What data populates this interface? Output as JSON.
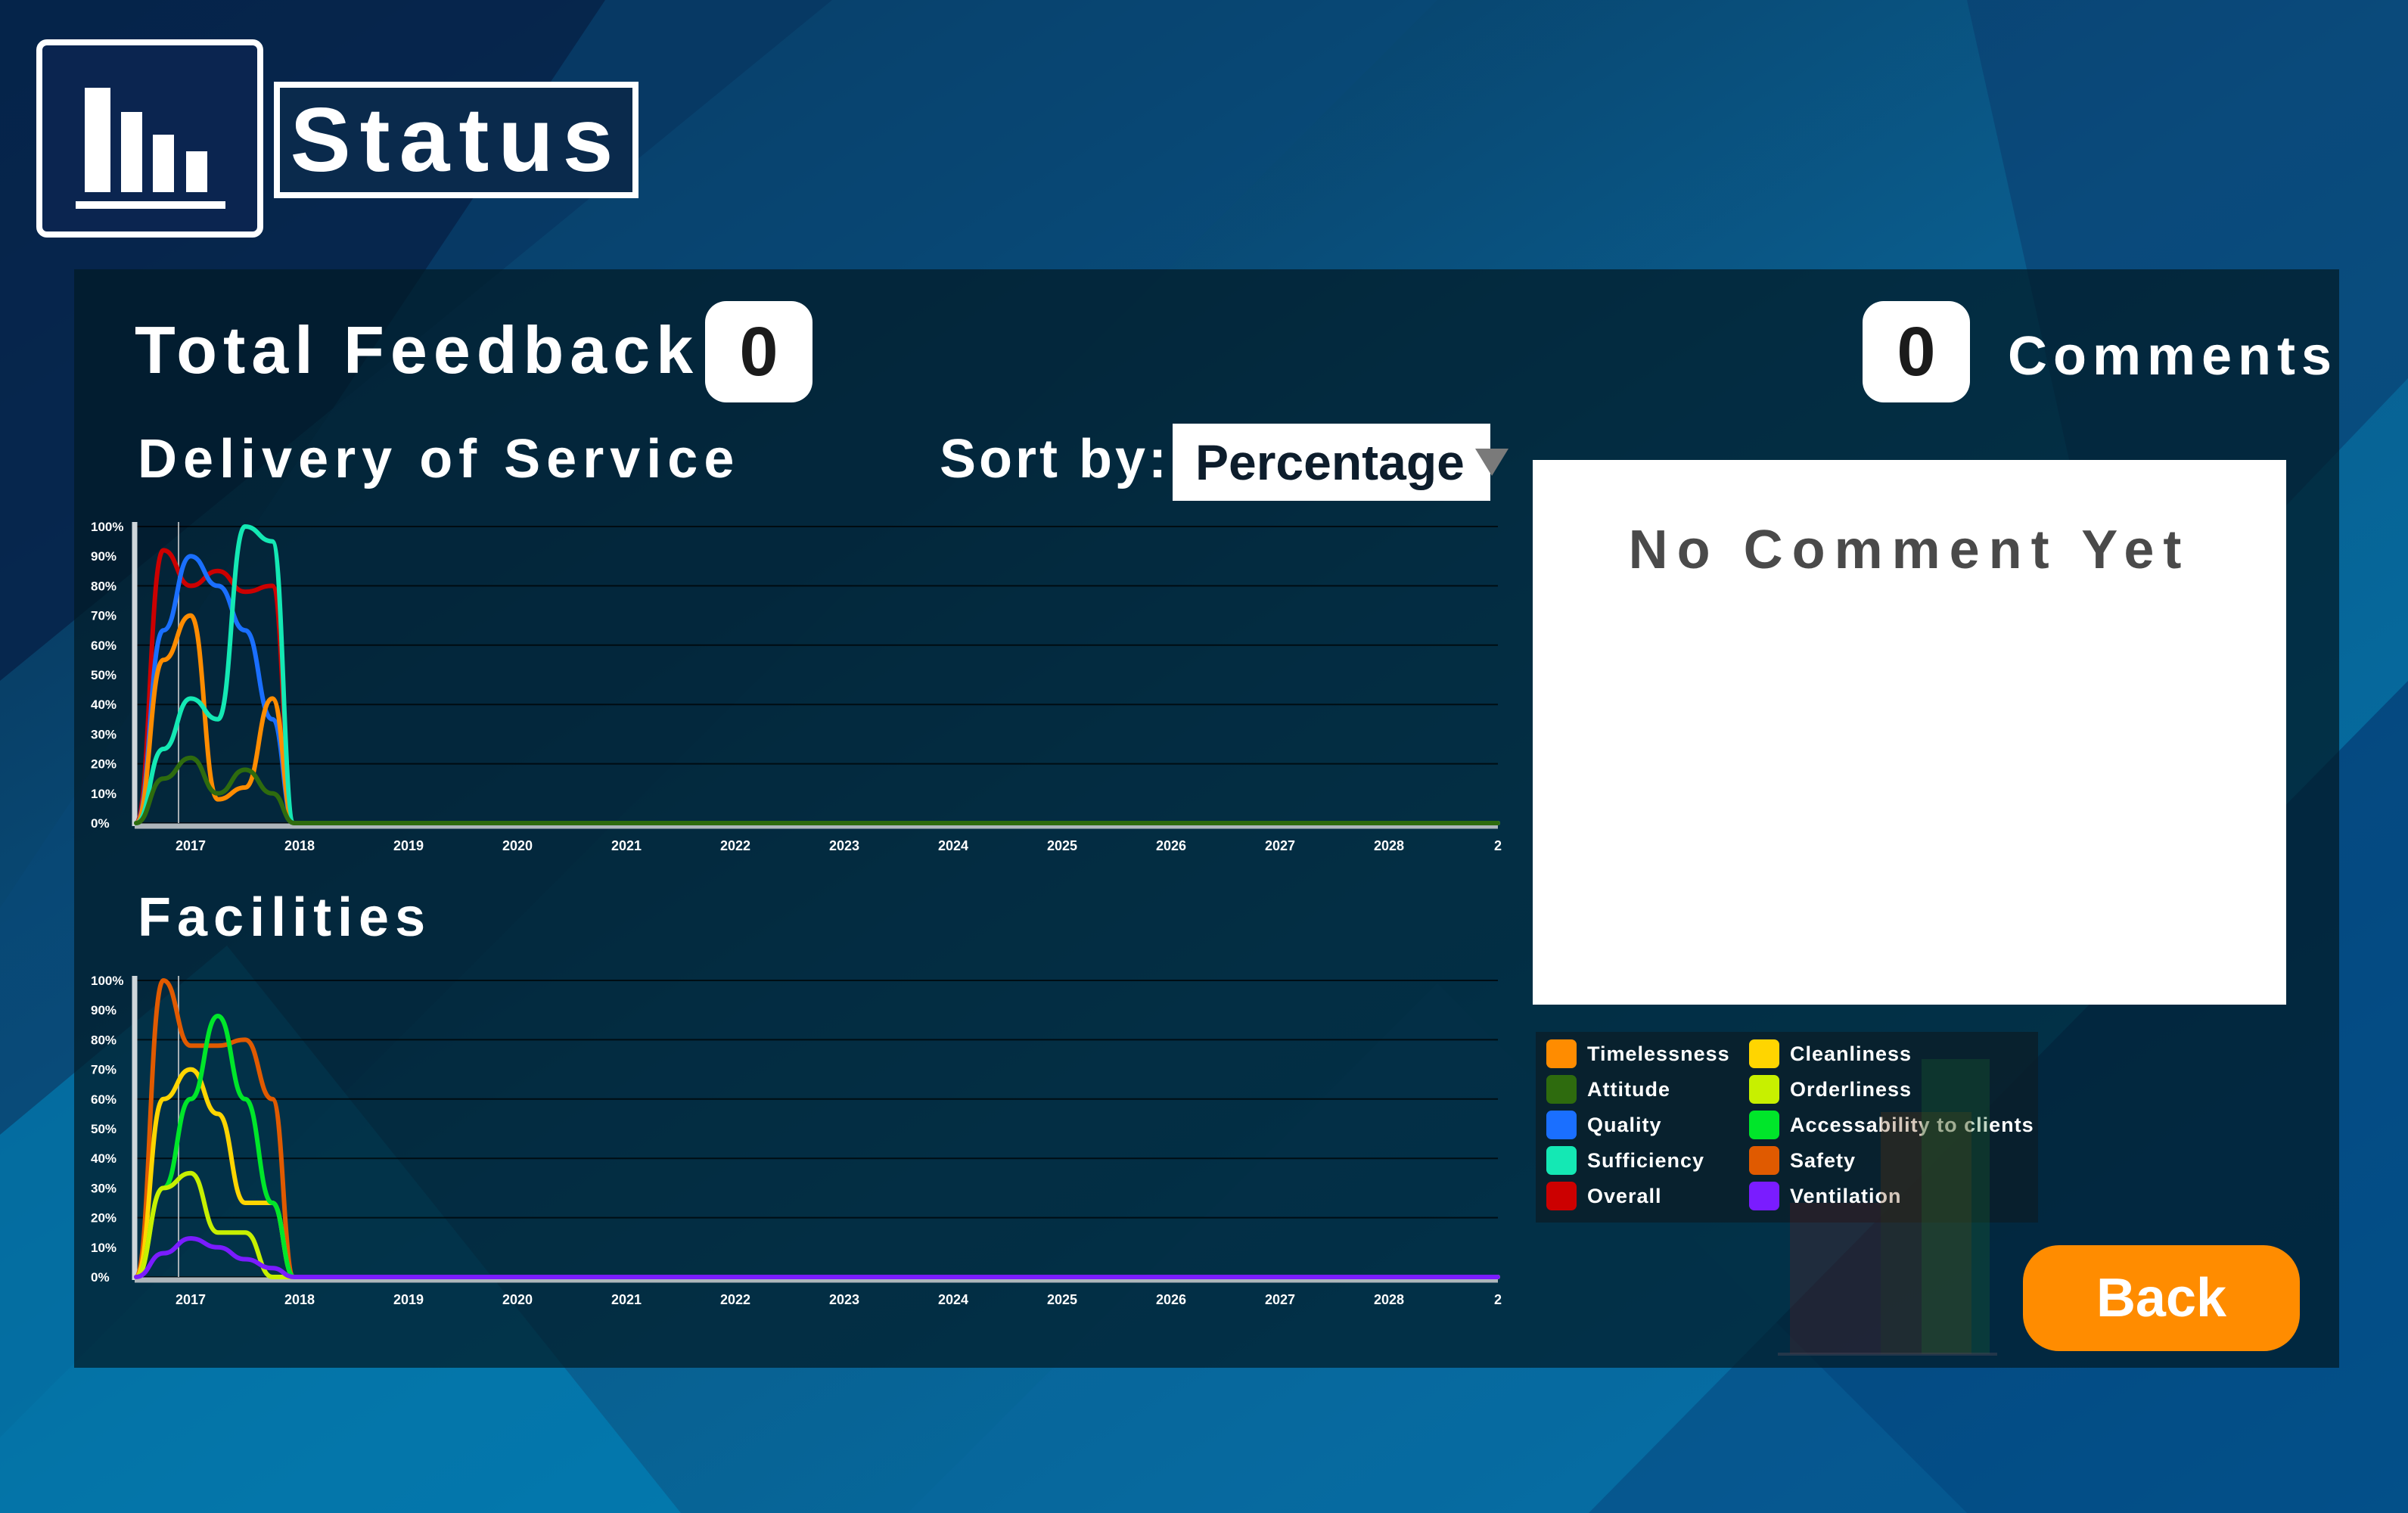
{
  "header": {
    "title": "Status",
    "icon": "bar-chart-icon"
  },
  "summary": {
    "total_feedback_label": "Total Feedback",
    "total_feedback_count": "0",
    "comments_count": "0",
    "comments_label": "Comments"
  },
  "sections": {
    "delivery_title": "Delivery of Service",
    "facilities_title": "Facilities"
  },
  "sort": {
    "label": "Sort by:",
    "value": "Percentage"
  },
  "comments_panel": {
    "empty_text": "No Comment Yet"
  },
  "legend": {
    "items": [
      {
        "label": "Timelessness",
        "color": "#ff8c00"
      },
      {
        "label": "Attitude",
        "color": "#2e6b0e"
      },
      {
        "label": "Quality",
        "color": "#1a6fff"
      },
      {
        "label": "Sufficiency",
        "color": "#14e8b4"
      },
      {
        "label": "Overall",
        "color": "#cc0000"
      },
      {
        "label": "Cleanliness",
        "color": "#ffd500"
      },
      {
        "label": "Orderliness",
        "color": "#c7f000"
      },
      {
        "label": "Accessability to clients",
        "color": "#00e62a"
      },
      {
        "label": "Safety",
        "color": "#e05a00"
      },
      {
        "label": "Ventilation",
        "color": "#7a1cff"
      }
    ]
  },
  "buttons": {
    "back": "Back"
  },
  "chart_data": [
    {
      "type": "line",
      "title": "Delivery of Service",
      "x": [
        "2016.5",
        "2016.75",
        "2017",
        "2017.25",
        "2017.5",
        "2017.75",
        "2017.95",
        "2018",
        "2019",
        "2020",
        "2021",
        "2022",
        "2023",
        "2024",
        "2025",
        "2026",
        "2027",
        "2028",
        "2029"
      ],
      "x_tick_labels": [
        "2017",
        "2018",
        "2019",
        "2020",
        "2021",
        "2022",
        "2023",
        "2024",
        "2025",
        "2026",
        "2027",
        "2028",
        "2"
      ],
      "y_tick_labels": [
        "0%",
        "10%",
        "20%",
        "30%",
        "40%",
        "50%",
        "60%",
        "70%",
        "80%",
        "90%",
        "100%"
      ],
      "ylim": [
        0,
        100
      ],
      "series": [
        {
          "name": "Overall",
          "color": "#cc0000",
          "values": [
            0,
            92,
            80,
            85,
            78,
            80,
            0,
            0,
            0,
            0,
            0,
            0,
            0,
            0,
            0,
            0,
            0,
            0,
            0
          ]
        },
        {
          "name": "Quality",
          "color": "#1a6fff",
          "values": [
            0,
            65,
            90,
            80,
            65,
            35,
            0,
            0,
            0,
            0,
            0,
            0,
            0,
            0,
            0,
            0,
            0,
            0,
            0
          ]
        },
        {
          "name": "Timelessness",
          "color": "#ff8c00",
          "values": [
            0,
            55,
            70,
            8,
            12,
            42,
            0,
            0,
            0,
            0,
            0,
            0,
            0,
            0,
            0,
            0,
            0,
            0,
            0
          ]
        },
        {
          "name": "Sufficiency",
          "color": "#14e8b4",
          "values": [
            0,
            25,
            42,
            35,
            100,
            95,
            0,
            0,
            0,
            0,
            0,
            0,
            0,
            0,
            0,
            0,
            0,
            0,
            0
          ]
        },
        {
          "name": "Attitude",
          "color": "#2e6b0e",
          "values": [
            0,
            15,
            22,
            10,
            18,
            10,
            0,
            0,
            0,
            0,
            0,
            0,
            0,
            0,
            0,
            0,
            0,
            0,
            0
          ]
        }
      ]
    },
    {
      "type": "line",
      "title": "Facilities",
      "x": [
        "2016.5",
        "2016.75",
        "2017",
        "2017.25",
        "2017.5",
        "2017.75",
        "2017.95",
        "2018",
        "2019",
        "2020",
        "2021",
        "2022",
        "2023",
        "2024",
        "2025",
        "2026",
        "2027",
        "2028",
        "2029"
      ],
      "x_tick_labels": [
        "2017",
        "2018",
        "2019",
        "2020",
        "2021",
        "2022",
        "2023",
        "2024",
        "2025",
        "2026",
        "2027",
        "2028",
        "2"
      ],
      "y_tick_labels": [
        "0%",
        "10%",
        "20%",
        "30%",
        "40%",
        "50%",
        "60%",
        "70%",
        "80%",
        "90%",
        "100%"
      ],
      "ylim": [
        0,
        100
      ],
      "series": [
        {
          "name": "Safety",
          "color": "#e05a00",
          "values": [
            0,
            100,
            78,
            78,
            80,
            60,
            0,
            0,
            0,
            0,
            0,
            0,
            0,
            0,
            0,
            0,
            0,
            0,
            0
          ]
        },
        {
          "name": "Cleanliness",
          "color": "#ffd500",
          "values": [
            0,
            60,
            70,
            55,
            25,
            25,
            0,
            0,
            0,
            0,
            0,
            0,
            0,
            0,
            0,
            0,
            0,
            0,
            0
          ]
        },
        {
          "name": "Accessability to clients",
          "color": "#00e62a",
          "values": [
            0,
            30,
            60,
            88,
            60,
            25,
            0,
            0,
            0,
            0,
            0,
            0,
            0,
            0,
            0,
            0,
            0,
            0,
            0
          ]
        },
        {
          "name": "Orderliness",
          "color": "#c7f000",
          "values": [
            0,
            30,
            35,
            15,
            15,
            0,
            0,
            0,
            0,
            0,
            0,
            0,
            0,
            0,
            0,
            0,
            0,
            0,
            0
          ]
        },
        {
          "name": "Ventilation",
          "color": "#7a1cff",
          "values": [
            0,
            8,
            13,
            10,
            6,
            3,
            0,
            0,
            0,
            0,
            0,
            0,
            0,
            0,
            0,
            0,
            0,
            0,
            0
          ]
        }
      ]
    }
  ]
}
